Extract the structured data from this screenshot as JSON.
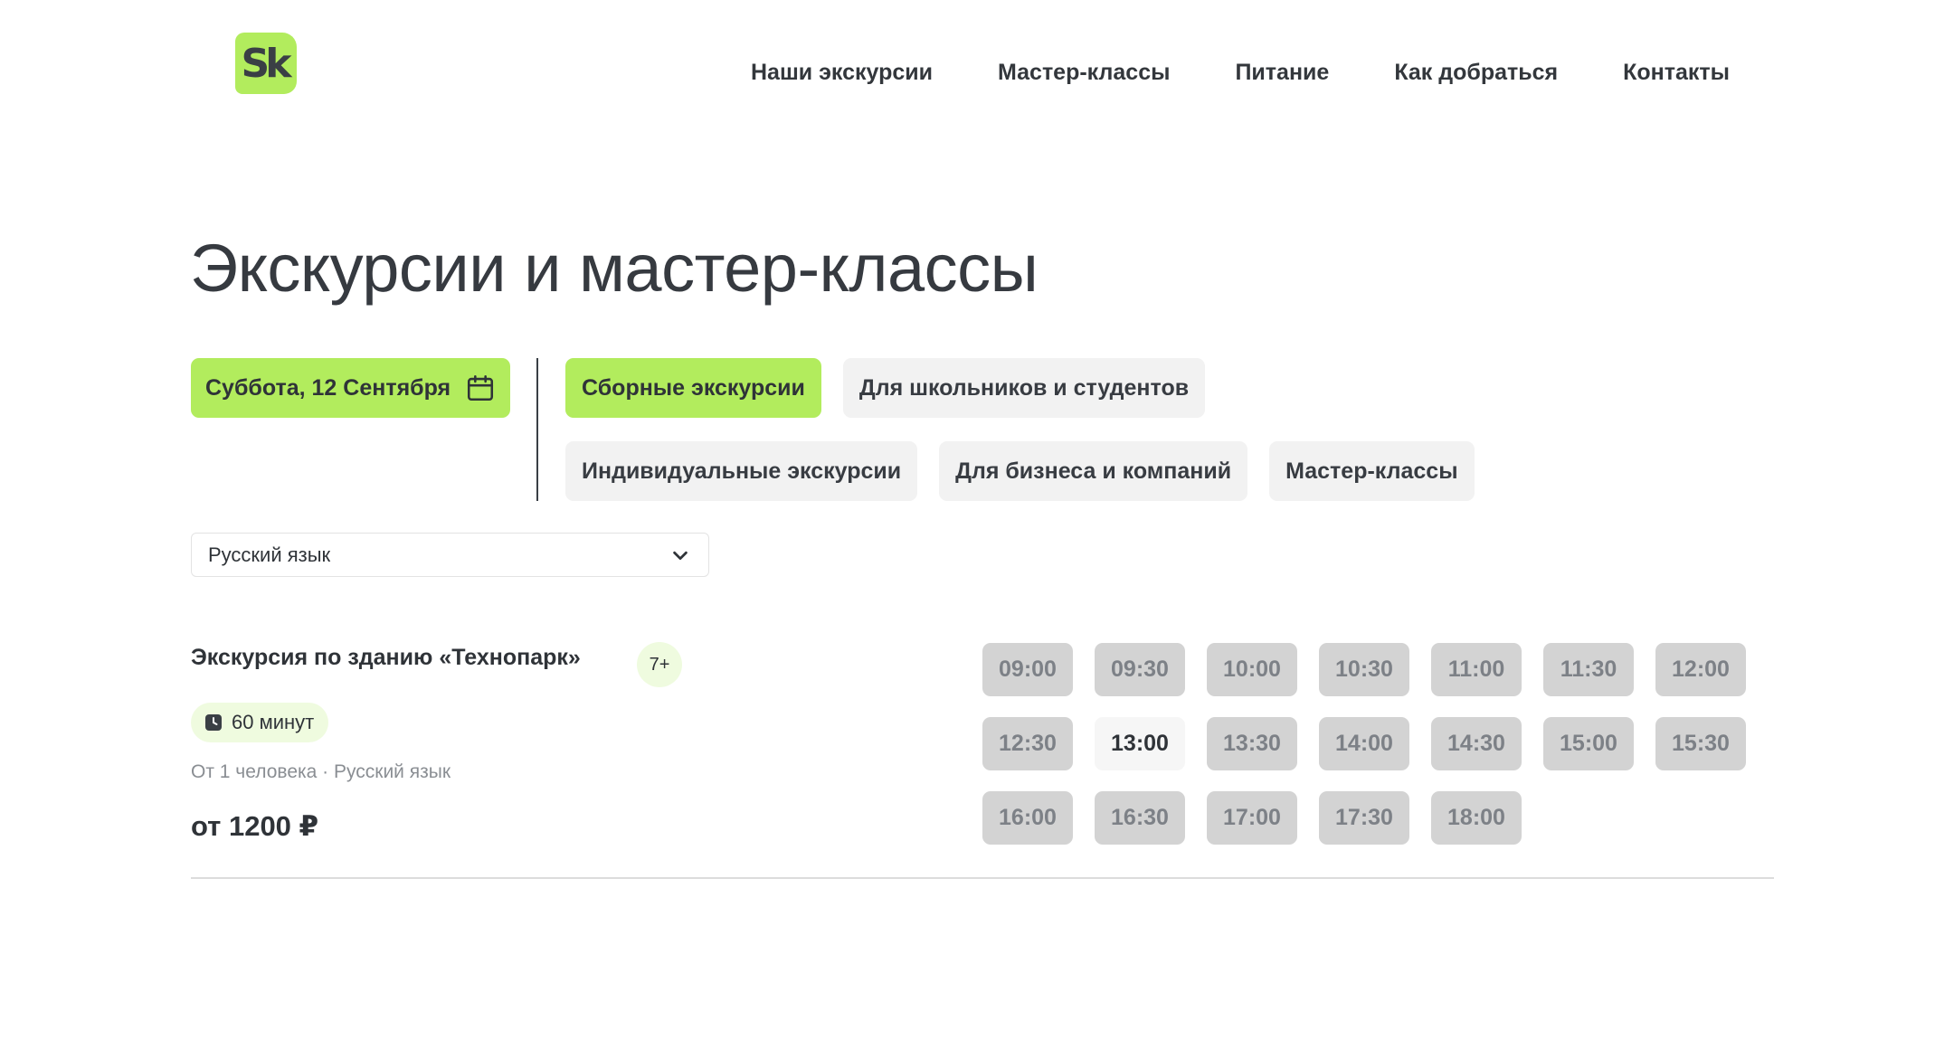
{
  "header": {
    "logo_text": "Sk",
    "nav": [
      {
        "label": "Наши экскурсии"
      },
      {
        "label": "Мастер-классы"
      },
      {
        "label": "Питание"
      },
      {
        "label": "Как добраться"
      },
      {
        "label": "Контакты"
      }
    ]
  },
  "main": {
    "title": "Экскурсии и мастер-классы",
    "date_button": {
      "label": "Суббота, 12 Сентября",
      "icon": "calendar-icon"
    },
    "filters": [
      {
        "label": "Сборные экскурсии",
        "active": true
      },
      {
        "label": "Для школьников и студентов",
        "active": false
      },
      {
        "label": "Индивидуальные экскурсии",
        "active": false
      },
      {
        "label": "Для бизнеса и компаний",
        "active": false
      },
      {
        "label": "Мастер-классы",
        "active": false
      }
    ],
    "language_select": {
      "value": "Русский язык",
      "icon": "chevron-down-icon"
    },
    "excursion": {
      "title": "Экскурсия по зданию «Технопарк»",
      "age": "7+",
      "duration": "60 минут",
      "duration_icon": "clock-icon",
      "meta": "От 1 человека · Русский язык",
      "price": "от 1200 ₽",
      "slots": [
        {
          "time": "09:00",
          "available": false
        },
        {
          "time": "09:30",
          "available": false
        },
        {
          "time": "10:00",
          "available": false
        },
        {
          "time": "10:30",
          "available": false
        },
        {
          "time": "11:00",
          "available": false
        },
        {
          "time": "11:30",
          "available": false
        },
        {
          "time": "12:00",
          "available": false
        },
        {
          "time": "12:30",
          "available": false
        },
        {
          "time": "13:00",
          "available": true
        },
        {
          "time": "13:30",
          "available": false
        },
        {
          "time": "14:00",
          "available": false
        },
        {
          "time": "14:30",
          "available": false
        },
        {
          "time": "15:00",
          "available": false
        },
        {
          "time": "15:30",
          "available": false
        },
        {
          "time": "16:00",
          "available": false
        },
        {
          "time": "16:30",
          "available": false
        },
        {
          "time": "17:00",
          "available": false
        },
        {
          "time": "17:30",
          "available": false
        },
        {
          "time": "18:00",
          "available": false
        }
      ]
    }
  },
  "colors": {
    "accent": "#b2ec5d",
    "accent_light": "#effbdf",
    "chip_bg": "#f2f2f2",
    "slot_disabled": "#d3d3d3",
    "text": "#2f3338"
  }
}
